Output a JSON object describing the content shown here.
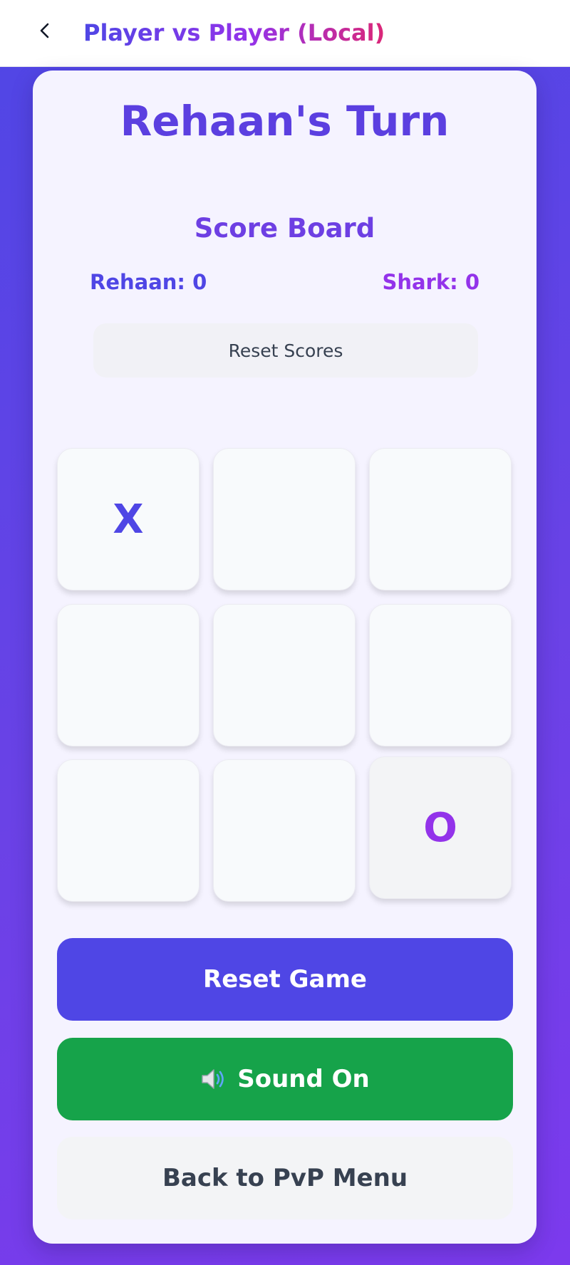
{
  "app_bar": {
    "title": "Player vs Player (Local)",
    "back_icon": "chevron-left-icon"
  },
  "game": {
    "turn_title": "Rehaan's Turn",
    "scoreboard_title": "Score Board",
    "score_player1": "Rehaan: 0",
    "score_player2": "Shark: 0",
    "reset_scores_label": "Reset Scores",
    "board": [
      "X",
      "",
      "",
      "",
      "",
      "",
      "",
      "",
      "O"
    ]
  },
  "actions": {
    "reset_game_label": "Reset Game",
    "sound_label": "Sound On",
    "sound_icon": "speaker-icon",
    "back_menu_label": "Back to PvP Menu"
  },
  "colors": {
    "primary": "#4f46e5",
    "secondary": "#9333ea",
    "sound_on": "#16a34a",
    "background_gradient_start": "#4f46e5",
    "background_gradient_end": "#7c3aed"
  }
}
